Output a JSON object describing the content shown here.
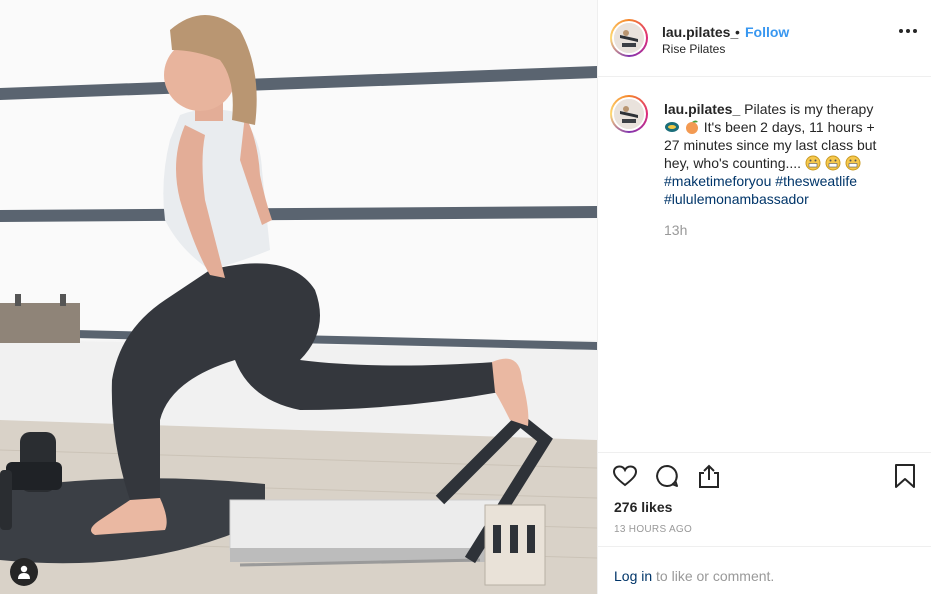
{
  "post": {
    "username": "lau.pilates_",
    "separator": "•",
    "follow_label": "Follow",
    "location": "Rise Pilates",
    "caption_prefix": "Pilates is my therapy",
    "caption_mid": "It's been 2 days, 11 hours + 27 minutes since my last class but hey, who's counting....",
    "hashtags": [
      "#maketimeforyou",
      "#thesweatlife",
      "#lululemonambassador"
    ],
    "time_ago": "13h",
    "likes": "276 likes",
    "posted_ago": "13 HOURS AGO",
    "login_link": "Log in",
    "login_rest": " to like or comment."
  },
  "icons": {
    "like": "heart-icon",
    "comment": "comment-icon",
    "share": "share-icon",
    "save": "bookmark-icon",
    "more": "more-options-icon",
    "user": "user-silhouette-icon"
  },
  "colors": {
    "follow": "#3897f0",
    "hashtag": "#003569",
    "muted": "#999999",
    "text": "#262626"
  }
}
